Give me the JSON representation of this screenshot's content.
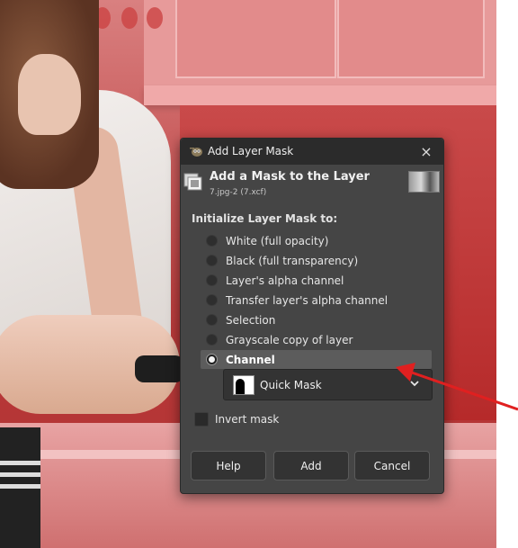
{
  "dialog": {
    "title": "Add Layer Mask",
    "header_title": "Add a Mask to the Layer",
    "header_subtitle": "7.jpg-2 (7.xcf)",
    "section_label": "Initialize Layer Mask to:",
    "options": [
      {
        "label": "White (full opacity)",
        "selected": false
      },
      {
        "label": "Black (full transparency)",
        "selected": false
      },
      {
        "label": "Layer's alpha channel",
        "selected": false
      },
      {
        "label": "Transfer layer's alpha channel",
        "selected": false
      },
      {
        "label": "Selection",
        "selected": false
      },
      {
        "label": "Grayscale copy of layer",
        "selected": false
      },
      {
        "label": "Channel",
        "selected": true
      }
    ],
    "channel_select": {
      "value": "Quick Mask",
      "icon": "quick-mask-thumbnail"
    },
    "invert_mask": {
      "label": "Invert mask",
      "checked": false
    },
    "buttons": {
      "help": "Help",
      "add": "Add",
      "cancel": "Cancel"
    },
    "close_icon": "×"
  },
  "annotation": {
    "arrow_color": "#e02020"
  },
  "colors": {
    "dialog_bg": "#454545",
    "titlebar_bg": "#2b2b2b",
    "selected_row": "#5c5c5c"
  }
}
